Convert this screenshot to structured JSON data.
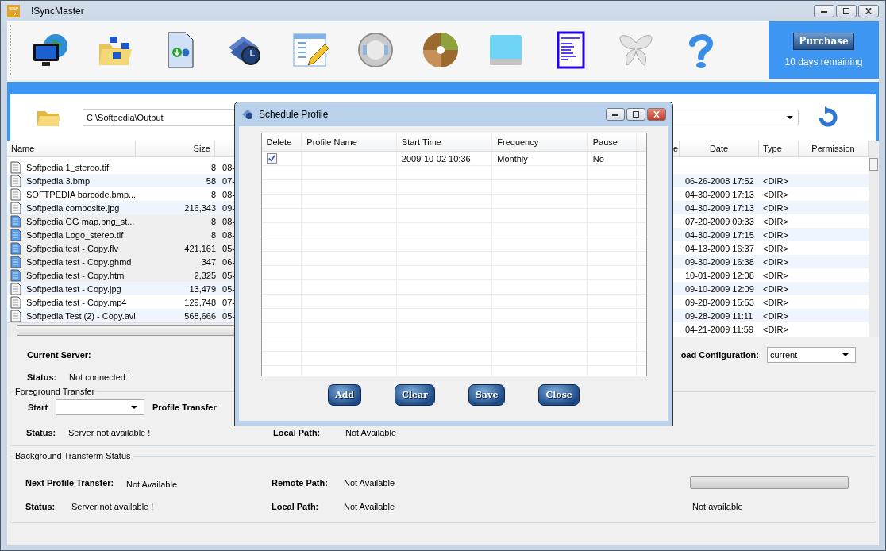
{
  "window": {
    "title": "!SyncMaster"
  },
  "purchase": {
    "button": "Purchase",
    "note": "10 days remaining"
  },
  "local_pane": {
    "path": "C:\\Softpedia\\Output",
    "columns": [
      "Name",
      "Size"
    ],
    "rows": [
      {
        "name": "Softpedia 1_stereo.tif",
        "size": "8",
        "column_3": "08-",
        "selected": false
      },
      {
        "name": "Softpedia 3.bmp",
        "size": "58",
        "column_3": "07-",
        "selected": false
      },
      {
        "name": "SOFTPEDIA barcode.bmp...",
        "size": "8",
        "column_3": "08-",
        "selected": false
      },
      {
        "name": "Softpedia composite.jpg",
        "size": "216,343",
        "column_3": "09-",
        "selected": false
      },
      {
        "name": "Softpedia GG map.png_st...",
        "size": "8",
        "column_3": "08-",
        "selected": true
      },
      {
        "name": "Softpedia Logo_stereo.tif",
        "size": "8",
        "column_3": "08-",
        "selected": true
      },
      {
        "name": "Softpedia test - Copy.flv",
        "size": "421,161",
        "column_3": "05-",
        "selected": true
      },
      {
        "name": "Softpedia test - Copy.ghmd",
        "size": "347",
        "column_3": "06-",
        "selected": true
      },
      {
        "name": "Softpedia test - Copy.html",
        "size": "2,325",
        "column_3": "05-",
        "selected": true
      },
      {
        "name": "Softpedia test - Copy.jpg",
        "size": "13,479",
        "column_3": "05-",
        "selected": false
      },
      {
        "name": "Softpedia test - Copy.mp4",
        "size": "129,748",
        "column_3": "07-",
        "selected": false
      },
      {
        "name": "Softpedia Test (2) - Copy.avi",
        "size": "568,666",
        "column_3": "05-",
        "selected": false
      }
    ]
  },
  "remote_pane": {
    "columns": [
      "e",
      "Date",
      "Type",
      "Permission"
    ],
    "rows": [
      {
        "date": "06-26-2008 17:52",
        "type": "<DIR>"
      },
      {
        "date": "04-30-2009 17:13",
        "type": "<DIR>"
      },
      {
        "date": "04-30-2009 17:13",
        "type": "<DIR>"
      },
      {
        "date": "07-20-2009 09:33",
        "type": "<DIR>"
      },
      {
        "date": "04-30-2009 17:15",
        "type": "<DIR>"
      },
      {
        "date": "04-13-2009 16:37",
        "type": "<DIR>"
      },
      {
        "date": "09-30-2009 16:38",
        "type": "<DIR>"
      },
      {
        "date": "10-01-2009 12:08",
        "type": "<DIR>"
      },
      {
        "date": "09-10-2009 12:09",
        "type": "<DIR>"
      },
      {
        "date": "09-28-2009 15:53",
        "type": "<DIR>"
      },
      {
        "date": "09-28-2009 11:11",
        "type": "<DIR>"
      },
      {
        "date": "04-21-2009 11:59",
        "type": "<DIR>"
      }
    ]
  },
  "connection": {
    "current_server_label": "Current Server:",
    "status_label": "Status:",
    "status": "Not connected !",
    "load_configuration_label": "oad Configuration:",
    "load_configuration": "current"
  },
  "foreground": {
    "title": "Foreground Transfer",
    "start_label": "Start",
    "profile_transfer_label": "Profile Transfer",
    "status_label": "Status:",
    "status": "Server not available !",
    "local_path_label": "Local Path:",
    "local_path": "Not Available"
  },
  "background": {
    "title": "Background Transferm Status",
    "next_label": "Next Profile Transfer:",
    "next": "Not Available",
    "remote_path_label": "Remote Path:",
    "remote_path": "Not Available",
    "status_label": "Status:",
    "status": "Server not available !",
    "local_path_label": "Local Path:",
    "local_path": "Not Available",
    "progress": {
      "level": 0
    },
    "progress_text": "Not available"
  },
  "dialog": {
    "title": "Schedule Profile",
    "columns": [
      "Delete",
      "Profile Name",
      "Start Time",
      "Frequency",
      "Pause"
    ],
    "rows": [
      {
        "delete": true,
        "start_time": "2009-10-02 10:36",
        "frequency": "Monthly",
        "pause": "No"
      }
    ],
    "buttons": [
      "Add",
      "Clear",
      "Save",
      "Close"
    ]
  }
}
